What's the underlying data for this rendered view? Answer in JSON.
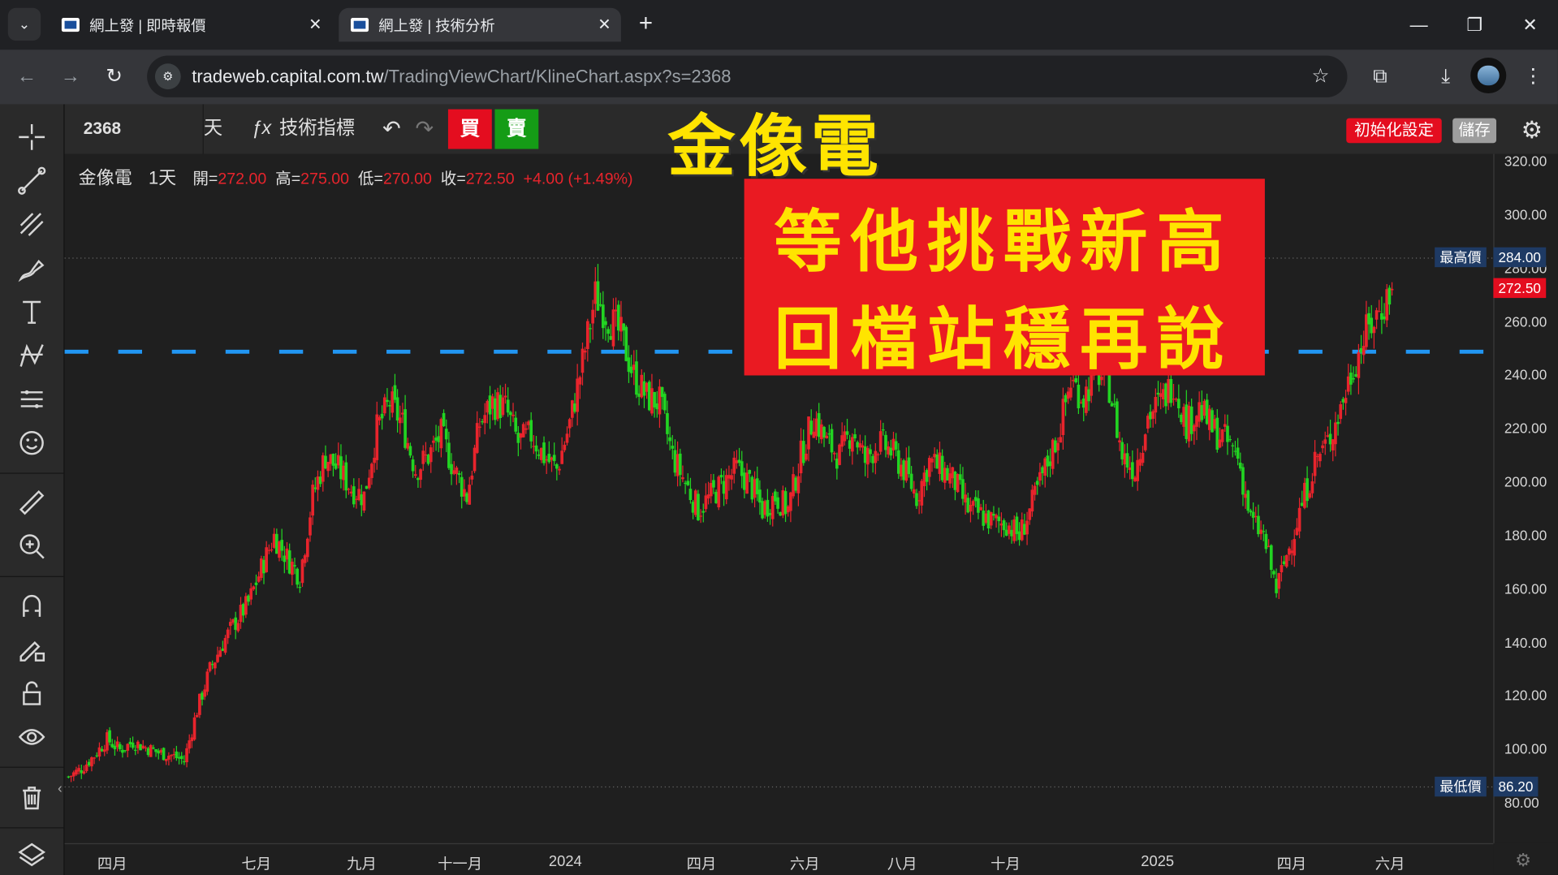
{
  "browser": {
    "tabs": [
      {
        "title": "網上發 | 即時報價",
        "active": false
      },
      {
        "title": "網上發 | 技術分析",
        "active": true
      }
    ],
    "url_host": "tradeweb.capital.com.tw",
    "url_path": "/TradingViewChart/KlineChart.aspx?s=2368"
  },
  "drawing_tools": [
    "crosshair-icon",
    "trend-line-icon",
    "fib-icon",
    "brush-icon",
    "text-icon",
    "pattern-icon",
    "forecast-icon",
    "emoji-icon",
    "ruler-icon",
    "zoom-in-icon",
    "magnet-icon",
    "lock-drawing-icon",
    "unlock-icon",
    "eye-icon",
    "trash-icon",
    "layers-icon"
  ],
  "header": {
    "symbol": "2368",
    "interval": "天",
    "indicators_label": "技術指標",
    "buy_label": "買",
    "sell_label": "賣",
    "reset_label": "初始化設定",
    "save_label": "儲存"
  },
  "legend": {
    "name": "金像電",
    "interval": "1天",
    "open_label": "開=",
    "open": "272.00",
    "high_label": "高=",
    "high": "275.00",
    "low_label": "低=",
    "low": "270.00",
    "close_label": "收=",
    "close": "272.50",
    "change": "+4.00 (+1.49%)"
  },
  "overlay": {
    "title": "金像電",
    "banner_line1": "等他挑戰新高",
    "banner_line2": "回檔站穩再說"
  },
  "colors": {
    "up": "#e8242c",
    "down": "#22d422",
    "dash_line": "#2196f3",
    "banner_bg": "#ea1a22",
    "banner_text": "#ffe400"
  },
  "chart_data": {
    "type": "candlestick",
    "y_ticks": [
      "320.00",
      "300.00",
      "280.00",
      "260.00",
      "240.00",
      "220.00",
      "200.00",
      "180.00",
      "160.00",
      "140.00",
      "120.00",
      "100.00",
      "80.00"
    ],
    "ylim": [
      78,
      322
    ],
    "x_labels": [
      "四月",
      "七月",
      "九月",
      "十一月",
      "2024",
      "四月",
      "六月",
      "八月",
      "十月",
      "2025",
      "四月",
      "六月"
    ],
    "highest_label": "最高價",
    "highest_value": "284.00",
    "lowest_label": "最低價",
    "lowest_value": "86.20",
    "last_price": "272.50",
    "horizontal_line": 249,
    "closes": [
      90,
      93,
      98,
      104,
      100,
      103,
      101,
      99,
      98,
      96,
      115,
      130,
      140,
      148,
      155,
      168,
      180,
      172,
      165,
      195,
      210,
      205,
      198,
      195,
      220,
      230,
      222,
      205,
      210,
      218,
      205,
      195,
      222,
      230,
      228,
      215,
      218,
      210,
      205,
      222,
      245,
      270,
      262,
      255,
      240,
      232,
      230,
      210,
      200,
      190,
      195,
      200,
      205,
      200,
      190,
      195,
      190,
      210,
      225,
      215,
      210,
      220,
      208,
      215,
      212,
      205,
      195,
      208,
      205,
      200,
      190,
      188,
      185,
      185,
      180,
      192,
      205,
      218,
      238,
      232,
      242,
      236,
      210,
      205,
      225,
      230,
      238,
      222,
      228,
      220,
      216,
      210,
      186,
      180,
      160,
      176,
      192,
      208,
      215,
      228,
      244,
      256,
      264,
      272.5
    ]
  }
}
